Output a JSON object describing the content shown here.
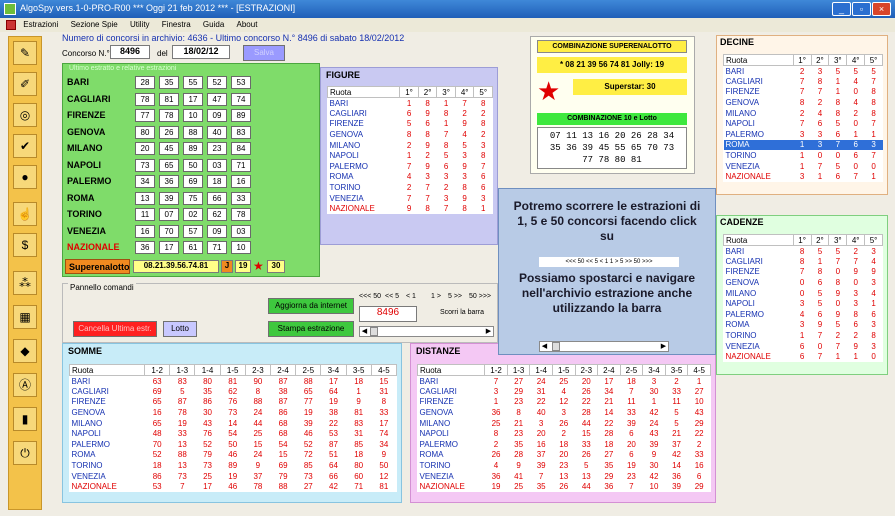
{
  "window": {
    "title": "AlgoSpy vers.1-0-PRO-R00  ***  Oggi 21 feb 2012  ***  - [ESTRAZIONI]",
    "buttons": [
      "_",
      "▫",
      "×"
    ]
  },
  "menu": [
    "Estrazioni",
    "Sezione Spie",
    "Utility",
    "Finestra",
    "Guida",
    "About"
  ],
  "info_line": "Numero di concorsi in archivio: 4636  -  Ultimo concorso N.° 8496 di sabato 18/02/2012",
  "concorso": {
    "label": "Concorso N.°",
    "number": "8496",
    "del_label": "del",
    "date": "18/02/12",
    "salva": "Salva"
  },
  "estrazioni_title": "Ultimo estratto e relative estrazioni",
  "estrazioni": [
    {
      "name": "BARI",
      "nums": [
        "28",
        "35",
        "55",
        "52",
        "53"
      ]
    },
    {
      "name": "CAGLIARI",
      "nums": [
        "78",
        "81",
        "17",
        "47",
        "74"
      ]
    },
    {
      "name": "FIRENZE",
      "nums": [
        "77",
        "78",
        "10",
        "09",
        "89"
      ]
    },
    {
      "name": "GENOVA",
      "nums": [
        "80",
        "26",
        "88",
        "40",
        "83"
      ]
    },
    {
      "name": "MILANO",
      "nums": [
        "20",
        "45",
        "89",
        "23",
        "84"
      ]
    },
    {
      "name": "NAPOLI",
      "nums": [
        "73",
        "65",
        "50",
        "03",
        "71"
      ]
    },
    {
      "name": "PALERMO",
      "nums": [
        "34",
        "36",
        "69",
        "18",
        "16"
      ]
    },
    {
      "name": "ROMA",
      "nums": [
        "13",
        "39",
        "75",
        "66",
        "33"
      ]
    },
    {
      "name": "TORINO",
      "nums": [
        "11",
        "07",
        "02",
        "62",
        "78"
      ]
    },
    {
      "name": "VENEZIA",
      "nums": [
        "16",
        "70",
        "57",
        "09",
        "03"
      ]
    },
    {
      "name": "NAZIONALE",
      "nums": [
        "36",
        "17",
        "61",
        "71",
        "10"
      ]
    }
  ],
  "superenalotto": {
    "label": "Superenalotto",
    "combo": "08.21.39.56.74.81",
    "j": "J",
    "jolly": "19",
    "star": "★",
    "superstar": "30"
  },
  "pannello": {
    "title": "Pannello comandi",
    "cancella": "Cancella Ultima estr.",
    "lotto": "Lotto",
    "aggiorna": "Aggiorna da internet",
    "stampa": "Stampa estrazione",
    "nav": [
      "<<< 50",
      "<< 5",
      "< 1",
      "1 >",
      "5 >>",
      "50 >>>"
    ],
    "counter": "8496",
    "scorri": "Scorri la barra"
  },
  "combinazione": {
    "title": "COMBINAZIONE SUPERENALOTTO",
    "line": "* 08 21 39 56 74 81   Jolly: 19",
    "superstar": "Superstar: 30",
    "title2": "COMBINAZIONE 10 e Lotto",
    "lines10": [
      "07 11 13 16 20 26 28 34",
      "35 36 39 45 55 65 70 73",
      "77 78 80 81"
    ]
  },
  "tooltip": {
    "text1": "Potremo scorrere le estrazioni di 1, 5 e 50 concorsi facendo click su",
    "nav": "<<< 50   << 5   < 1     1 >   5 >>   50 >>>",
    "text2": "Possiamo spostarci e navigare nell'archivio estrazione anche utilizzando la barra"
  },
  "figure": {
    "title": "FIGURE",
    "headers": [
      "Ruota",
      "1°",
      "2°",
      "3°",
      "4°",
      "5°"
    ],
    "rows": [
      [
        "BARI",
        "1",
        "8",
        "1",
        "7",
        "8"
      ],
      [
        "CAGLIARI",
        "6",
        "9",
        "8",
        "2",
        "2"
      ],
      [
        "FIRENZE",
        "5",
        "6",
        "1",
        "9",
        "8"
      ],
      [
        "GENOVA",
        "8",
        "8",
        "7",
        "4",
        "2"
      ],
      [
        "MILANO",
        "2",
        "9",
        "8",
        "5",
        "3"
      ],
      [
        "NAPOLI",
        "1",
        "2",
        "5",
        "3",
        "8"
      ],
      [
        "PALERMO",
        "7",
        "9",
        "6",
        "9",
        "7"
      ],
      [
        "ROMA",
        "4",
        "3",
        "3",
        "3",
        "6"
      ],
      [
        "TORINO",
        "2",
        "7",
        "2",
        "8",
        "6"
      ],
      [
        "VENEZIA",
        "7",
        "7",
        "3",
        "9",
        "3"
      ],
      [
        "NAZIONALE",
        "9",
        "8",
        "7",
        "8",
        "1"
      ]
    ]
  },
  "decine": {
    "title": "DECINE",
    "headers": [
      "Ruota",
      "1°",
      "2°",
      "3°",
      "4°",
      "5°"
    ],
    "rows": [
      [
        "BARI",
        "2",
        "3",
        "5",
        "5",
        "5"
      ],
      [
        "CAGLIARI",
        "7",
        "8",
        "1",
        "4",
        "7"
      ],
      [
        "FIRENZE",
        "7",
        "7",
        "1",
        "0",
        "8"
      ],
      [
        "GENOVA",
        "8",
        "2",
        "8",
        "4",
        "8"
      ],
      [
        "MILANO",
        "2",
        "4",
        "8",
        "2",
        "8"
      ],
      [
        "NAPOLI",
        "7",
        "6",
        "5",
        "0",
        "7"
      ],
      [
        "PALERMO",
        "3",
        "3",
        "6",
        "1",
        "1"
      ],
      [
        "ROMA",
        "1",
        "3",
        "7",
        "6",
        "3"
      ],
      [
        "TORINO",
        "1",
        "0",
        "0",
        "6",
        "7"
      ],
      [
        "VENEZIA",
        "1",
        "7",
        "5",
        "0",
        "0"
      ],
      [
        "NAZIONALE",
        "3",
        "1",
        "6",
        "7",
        "1"
      ]
    ]
  },
  "cadenze": {
    "title": "CADENZE",
    "headers": [
      "Ruota",
      "1°",
      "2°",
      "3°",
      "4°",
      "5°"
    ],
    "rows": [
      [
        "BARI",
        "8",
        "5",
        "5",
        "2",
        "3"
      ],
      [
        "CAGLIARI",
        "8",
        "1",
        "7",
        "7",
        "4"
      ],
      [
        "FIRENZE",
        "7",
        "8",
        "0",
        "9",
        "9"
      ],
      [
        "GENOVA",
        "0",
        "6",
        "8",
        "0",
        "3"
      ],
      [
        "MILANO",
        "0",
        "5",
        "9",
        "3",
        "4"
      ],
      [
        "NAPOLI",
        "3",
        "5",
        "0",
        "3",
        "1"
      ],
      [
        "PALERMO",
        "4",
        "6",
        "9",
        "8",
        "6"
      ],
      [
        "ROMA",
        "3",
        "9",
        "5",
        "6",
        "3"
      ],
      [
        "TORINO",
        "1",
        "7",
        "2",
        "2",
        "8"
      ],
      [
        "VENEZIA",
        "6",
        "0",
        "7",
        "9",
        "3"
      ],
      [
        "NAZIONALE",
        "6",
        "7",
        "1",
        "1",
        "0"
      ]
    ]
  },
  "somme": {
    "title": "SOMME",
    "headers": [
      "Ruota",
      "1-2",
      "1-3",
      "1-4",
      "1-5",
      "2-3",
      "2-4",
      "2-5",
      "3-4",
      "3-5",
      "4-5"
    ],
    "rows": [
      [
        "BARI",
        "63",
        "83",
        "80",
        "81",
        "90",
        "87",
        "88",
        "17",
        "18",
        "15"
      ],
      [
        "CAGLIARI",
        "69",
        "5",
        "35",
        "62",
        "8",
        "38",
        "65",
        "64",
        "1",
        "31"
      ],
      [
        "FIRENZE",
        "65",
        "87",
        "86",
        "76",
        "88",
        "87",
        "77",
        "19",
        "9",
        "8"
      ],
      [
        "GENOVA",
        "16",
        "78",
        "30",
        "73",
        "24",
        "86",
        "19",
        "38",
        "81",
        "33"
      ],
      [
        "MILANO",
        "65",
        "19",
        "43",
        "14",
        "44",
        "68",
        "39",
        "22",
        "83",
        "17"
      ],
      [
        "NAPOLI",
        "48",
        "33",
        "76",
        "54",
        "25",
        "68",
        "46",
        "53",
        "31",
        "74"
      ],
      [
        "PALERMO",
        "70",
        "13",
        "52",
        "50",
        "15",
        "54",
        "52",
        "87",
        "85",
        "34"
      ],
      [
        "ROMA",
        "52",
        "88",
        "79",
        "46",
        "24",
        "15",
        "72",
        "51",
        "18",
        "9"
      ],
      [
        "TORINO",
        "18",
        "13",
        "73",
        "89",
        "9",
        "69",
        "85",
        "64",
        "80",
        "50"
      ],
      [
        "VENEZIA",
        "86",
        "73",
        "25",
        "19",
        "37",
        "79",
        "73",
        "66",
        "60",
        "12"
      ],
      [
        "NAZIONALE",
        "53",
        "7",
        "17",
        "46",
        "78",
        "88",
        "27",
        "42",
        "71",
        "81"
      ]
    ]
  },
  "distanze": {
    "title": "DISTANZE",
    "headers": [
      "Ruota",
      "1-2",
      "1-3",
      "1-4",
      "1-5",
      "2-3",
      "2-4",
      "2-5",
      "3-4",
      "3-5",
      "4-5"
    ],
    "rows": [
      [
        "BARI",
        "7",
        "27",
        "24",
        "25",
        "20",
        "17",
        "18",
        "3",
        "2",
        "1"
      ],
      [
        "CAGLIARI",
        "3",
        "29",
        "31",
        "4",
        "26",
        "34",
        "7",
        "30",
        "33",
        "27"
      ],
      [
        "FIRENZE",
        "1",
        "23",
        "22",
        "12",
        "22",
        "21",
        "11",
        "1",
        "11",
        "10"
      ],
      [
        "GENOVA",
        "36",
        "8",
        "40",
        "3",
        "28",
        "14",
        "33",
        "42",
        "5",
        "43"
      ],
      [
        "MILANO",
        "25",
        "21",
        "3",
        "26",
        "44",
        "22",
        "39",
        "24",
        "5",
        "29"
      ],
      [
        "NAPOLI",
        "8",
        "23",
        "20",
        "2",
        "15",
        "28",
        "6",
        "43",
        "21",
        "22"
      ],
      [
        "PALERMO",
        "2",
        "35",
        "16",
        "18",
        "33",
        "18",
        "20",
        "39",
        "37",
        "2"
      ],
      [
        "ROMA",
        "26",
        "28",
        "37",
        "20",
        "26",
        "27",
        "6",
        "9",
        "42",
        "33"
      ],
      [
        "TORINO",
        "4",
        "9",
        "39",
        "23",
        "5",
        "35",
        "19",
        "30",
        "14",
        "16"
      ],
      [
        "VENEZIA",
        "36",
        "41",
        "7",
        "13",
        "13",
        "29",
        "23",
        "42",
        "36",
        "6"
      ],
      [
        "NAZIONALE",
        "19",
        "25",
        "35",
        "26",
        "44",
        "36",
        "7",
        "10",
        "39",
        "29"
      ]
    ]
  }
}
